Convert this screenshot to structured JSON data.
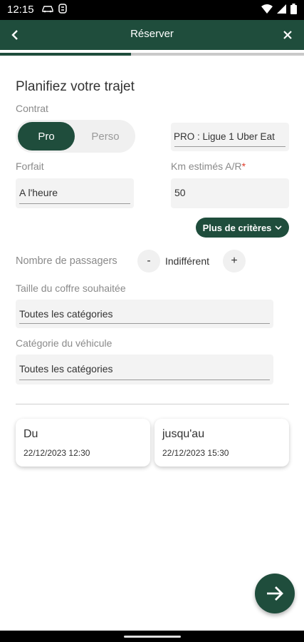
{
  "status_bar": {
    "time": "12:15"
  },
  "header": {
    "title": "Réserver"
  },
  "progress": {
    "fraction": 0.43
  },
  "form": {
    "section_title": "Planifiez votre trajet",
    "contrat": {
      "label": "Contrat",
      "options": [
        "Pro",
        "Perso"
      ],
      "selected": "Pro",
      "value": "PRO : Ligue 1 Uber Eat"
    },
    "forfait": {
      "label": "Forfait",
      "value": "A l'heure"
    },
    "km": {
      "label": "Km estimés A/R",
      "required_mark": "*",
      "value": "50"
    },
    "more_criteria_label": "Plus de critères",
    "passengers": {
      "label": "Nombre de passagers",
      "minus": "-",
      "value": "Indifférent",
      "plus": "+"
    },
    "trunk": {
      "label": "Taille du coffre souhaitée",
      "value": "Toutes les catégories"
    },
    "vehicle": {
      "label": "Catégorie du véhicule",
      "value": "Toutes les catégories"
    }
  },
  "dates": {
    "from": {
      "title": "Du",
      "value": "22/12/2023 12:30"
    },
    "to": {
      "title": "jusqu'au",
      "value": "22/12/2023 15:30"
    }
  },
  "colors": {
    "brand": "#1f4d3c",
    "required": "#e03b2a"
  },
  "icons": {
    "back": "arrow-left-icon",
    "close": "close-icon",
    "chevron": "chevron-down-icon",
    "next": "arrow-right-icon"
  }
}
